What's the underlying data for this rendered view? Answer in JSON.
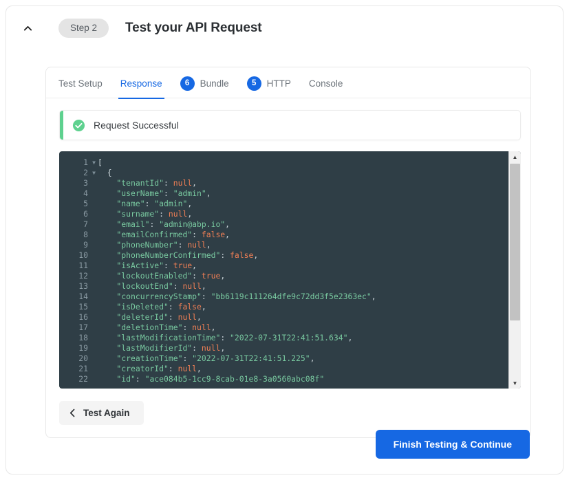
{
  "header": {
    "collapse_icon": "chevron-up-icon",
    "step_label": "Step 2",
    "title": "Test your API Request"
  },
  "tabs": [
    {
      "label": "Test Setup",
      "badge": null,
      "active": false
    },
    {
      "label": "Response",
      "badge": null,
      "active": true
    },
    {
      "label": "Bundle",
      "badge": "6",
      "active": false
    },
    {
      "label": "HTTP",
      "badge": "5",
      "active": false
    },
    {
      "label": "Console",
      "badge": null,
      "active": false
    }
  ],
  "alert": {
    "icon": "check-circle-icon",
    "message": "Request Successful",
    "accent_color": "#5ed18f"
  },
  "editor": {
    "background": "#2f3e46",
    "lines": [
      {
        "n": "1",
        "fold": true,
        "segments": [
          {
            "t": "[",
            "c": "p"
          }
        ]
      },
      {
        "n": "2",
        "fold": true,
        "segments": [
          {
            "t": "  {",
            "c": "p"
          }
        ]
      },
      {
        "n": "3",
        "fold": false,
        "segments": [
          {
            "t": "    \"tenantId\"",
            "c": "k"
          },
          {
            "t": ": ",
            "c": "p"
          },
          {
            "t": "null",
            "c": "v"
          },
          {
            "t": ",",
            "c": "p"
          }
        ]
      },
      {
        "n": "4",
        "fold": false,
        "segments": [
          {
            "t": "    \"userName\"",
            "c": "k"
          },
          {
            "t": ": ",
            "c": "p"
          },
          {
            "t": "\"admin\"",
            "c": "s"
          },
          {
            "t": ",",
            "c": "p"
          }
        ]
      },
      {
        "n": "5",
        "fold": false,
        "segments": [
          {
            "t": "    \"name\"",
            "c": "k"
          },
          {
            "t": ": ",
            "c": "p"
          },
          {
            "t": "\"admin\"",
            "c": "s"
          },
          {
            "t": ",",
            "c": "p"
          }
        ]
      },
      {
        "n": "6",
        "fold": false,
        "segments": [
          {
            "t": "    \"surname\"",
            "c": "k"
          },
          {
            "t": ": ",
            "c": "p"
          },
          {
            "t": "null",
            "c": "v"
          },
          {
            "t": ",",
            "c": "p"
          }
        ]
      },
      {
        "n": "7",
        "fold": false,
        "segments": [
          {
            "t": "    \"email\"",
            "c": "k"
          },
          {
            "t": ": ",
            "c": "p"
          },
          {
            "t": "\"admin@abp.io\"",
            "c": "s"
          },
          {
            "t": ",",
            "c": "p"
          }
        ]
      },
      {
        "n": "8",
        "fold": false,
        "segments": [
          {
            "t": "    \"emailConfirmed\"",
            "c": "k"
          },
          {
            "t": ": ",
            "c": "p"
          },
          {
            "t": "false",
            "c": "v"
          },
          {
            "t": ",",
            "c": "p"
          }
        ]
      },
      {
        "n": "9",
        "fold": false,
        "segments": [
          {
            "t": "    \"phoneNumber\"",
            "c": "k"
          },
          {
            "t": ": ",
            "c": "p"
          },
          {
            "t": "null",
            "c": "v"
          },
          {
            "t": ",",
            "c": "p"
          }
        ]
      },
      {
        "n": "10",
        "fold": false,
        "segments": [
          {
            "t": "    \"phoneNumberConfirmed\"",
            "c": "k"
          },
          {
            "t": ": ",
            "c": "p"
          },
          {
            "t": "false",
            "c": "v"
          },
          {
            "t": ",",
            "c": "p"
          }
        ]
      },
      {
        "n": "11",
        "fold": false,
        "segments": [
          {
            "t": "    \"isActive\"",
            "c": "k"
          },
          {
            "t": ": ",
            "c": "p"
          },
          {
            "t": "true",
            "c": "v"
          },
          {
            "t": ",",
            "c": "p"
          }
        ]
      },
      {
        "n": "12",
        "fold": false,
        "segments": [
          {
            "t": "    \"lockoutEnabled\"",
            "c": "k"
          },
          {
            "t": ": ",
            "c": "p"
          },
          {
            "t": "true",
            "c": "v"
          },
          {
            "t": ",",
            "c": "p"
          }
        ]
      },
      {
        "n": "13",
        "fold": false,
        "segments": [
          {
            "t": "    \"lockoutEnd\"",
            "c": "k"
          },
          {
            "t": ": ",
            "c": "p"
          },
          {
            "t": "null",
            "c": "v"
          },
          {
            "t": ",",
            "c": "p"
          }
        ]
      },
      {
        "n": "14",
        "fold": false,
        "segments": [
          {
            "t": "    \"concurrencyStamp\"",
            "c": "k"
          },
          {
            "t": ": ",
            "c": "p"
          },
          {
            "t": "\"bb6119c111264dfe9c72dd3f5e2363ec\"",
            "c": "s"
          },
          {
            "t": ",",
            "c": "p"
          }
        ]
      },
      {
        "n": "15",
        "fold": false,
        "segments": [
          {
            "t": "    \"isDeleted\"",
            "c": "k"
          },
          {
            "t": ": ",
            "c": "p"
          },
          {
            "t": "false",
            "c": "v"
          },
          {
            "t": ",",
            "c": "p"
          }
        ]
      },
      {
        "n": "16",
        "fold": false,
        "segments": [
          {
            "t": "    \"deleterId\"",
            "c": "k"
          },
          {
            "t": ": ",
            "c": "p"
          },
          {
            "t": "null",
            "c": "v"
          },
          {
            "t": ",",
            "c": "p"
          }
        ]
      },
      {
        "n": "17",
        "fold": false,
        "segments": [
          {
            "t": "    \"deletionTime\"",
            "c": "k"
          },
          {
            "t": ": ",
            "c": "p"
          },
          {
            "t": "null",
            "c": "v"
          },
          {
            "t": ",",
            "c": "p"
          }
        ]
      },
      {
        "n": "18",
        "fold": false,
        "segments": [
          {
            "t": "    \"lastModificationTime\"",
            "c": "k"
          },
          {
            "t": ": ",
            "c": "p"
          },
          {
            "t": "\"2022-07-31T22:41:51.634\"",
            "c": "s"
          },
          {
            "t": ",",
            "c": "p"
          }
        ]
      },
      {
        "n": "19",
        "fold": false,
        "segments": [
          {
            "t": "    \"lastModifierId\"",
            "c": "k"
          },
          {
            "t": ": ",
            "c": "p"
          },
          {
            "t": "null",
            "c": "v"
          },
          {
            "t": ",",
            "c": "p"
          }
        ]
      },
      {
        "n": "20",
        "fold": false,
        "segments": [
          {
            "t": "    \"creationTime\"",
            "c": "k"
          },
          {
            "t": ": ",
            "c": "p"
          },
          {
            "t": "\"2022-07-31T22:41:51.225\"",
            "c": "s"
          },
          {
            "t": ",",
            "c": "p"
          }
        ]
      },
      {
        "n": "21",
        "fold": false,
        "segments": [
          {
            "t": "    \"creatorId\"",
            "c": "k"
          },
          {
            "t": ": ",
            "c": "p"
          },
          {
            "t": "null",
            "c": "v"
          },
          {
            "t": ",",
            "c": "p"
          }
        ]
      },
      {
        "n": "22",
        "fold": false,
        "segments": [
          {
            "t": "    \"id\"",
            "c": "k"
          },
          {
            "t": ": ",
            "c": "p"
          },
          {
            "t": "\"ace084b5-1cc9-8cab-01e8-3a0560abc08f\"",
            "c": "s"
          }
        ]
      }
    ]
  },
  "footer": {
    "test_again_label": "Test Again",
    "test_again_icon": "chevron-left-icon",
    "finish_label": "Finish Testing & Continue",
    "accent_color": "#1668e3"
  }
}
